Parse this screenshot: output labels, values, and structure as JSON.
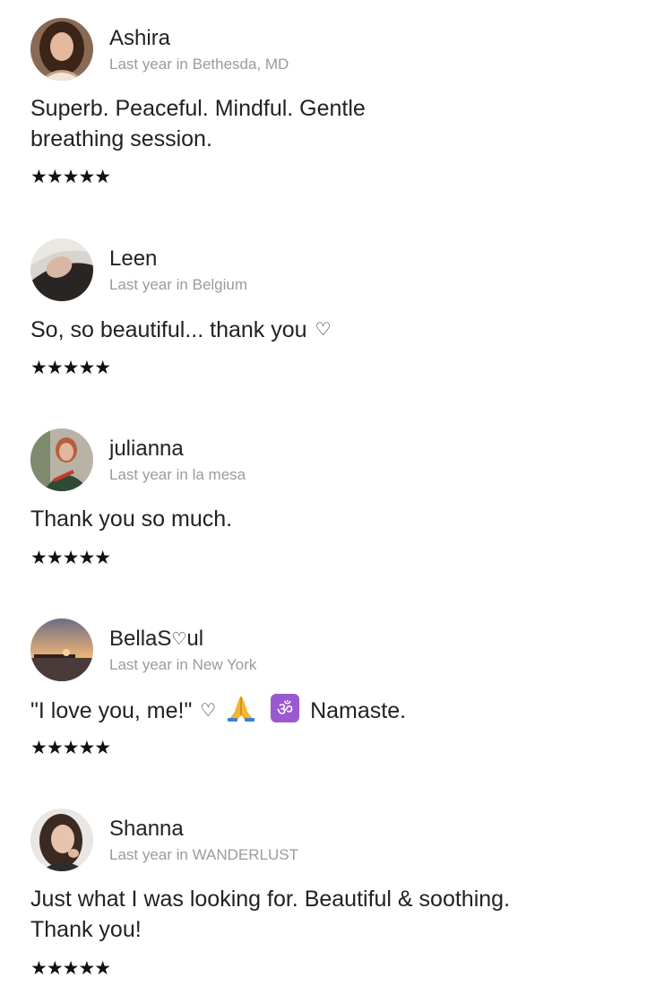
{
  "reviews": [
    {
      "name": "Ashira",
      "meta": "Last year in Bethesda, MD",
      "text_lines": [
        "Superb. Peaceful. Mindful. Gentle",
        "breathing session."
      ],
      "stars": "★★★★★",
      "rating": 5,
      "avatar_icon": "woman-curly-hair-avatar"
    },
    {
      "name": "Leen",
      "meta": "Last year in Belgium",
      "text": "So, so beautiful... thank you",
      "text_icon": "heart-outline-icon",
      "stars": "★★★★★",
      "rating": 5,
      "avatar_icon": "woman-lying-avatar"
    },
    {
      "name": "julianna",
      "meta": "Last year in la mesa",
      "text": "Thank you so much.",
      "stars": "★★★★★",
      "rating": 5,
      "avatar_icon": "woman-green-sweater-avatar"
    },
    {
      "name_prefix": "BellaS",
      "name_suffix": "ul",
      "name_icon": "heart-outline-icon",
      "meta": "Last year in New York",
      "text_start": "\"I love you, me!\"",
      "text_end": "Namaste.",
      "text_icons": [
        "heart-outline-icon",
        "folded-hands-icon",
        "om-symbol-icon"
      ],
      "stars": "★★★★★",
      "rating": 5,
      "avatar_icon": "sunset-pier-avatar"
    },
    {
      "name": "Shanna",
      "meta": "Last year in WANDERLUST",
      "text_lines": [
        "Just what I was looking for. Beautiful & soothing.",
        "Thank you!"
      ],
      "stars": "★★★★★",
      "rating": 5,
      "avatar_icon": "woman-smiling-avatar"
    }
  ],
  "glyphs": {
    "heart": "♡",
    "om": "ॐ"
  },
  "colors": {
    "name": "#222222",
    "meta": "#9b9ba0",
    "text": "#222222",
    "stars": "#111111",
    "om_badge": "#9b59d0"
  }
}
